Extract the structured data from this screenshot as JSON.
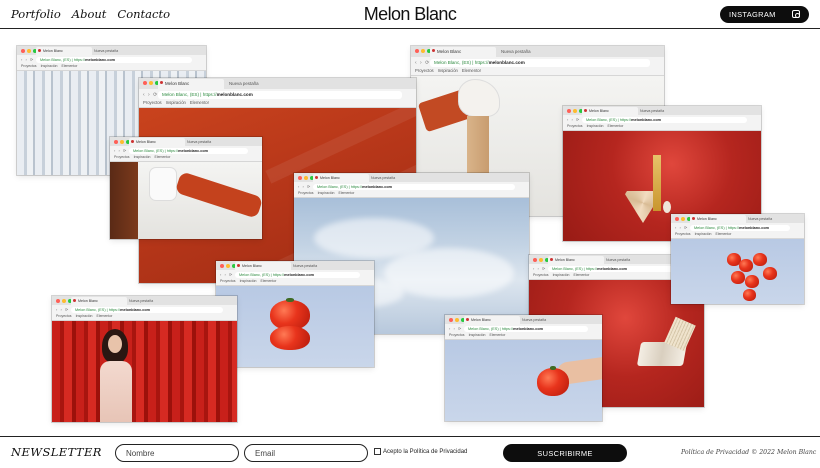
{
  "header": {
    "nav": [
      "Portfolio",
      "About",
      "Contacto"
    ],
    "brand": "Melon Blanc",
    "instagram_label": "INSTAGRAM"
  },
  "browser": {
    "tab_title": "Melon Blanc",
    "new_tab": "Nueva pestaña",
    "address_prefix": "Melon Blanc, (ES) | https://",
    "address_domain": "melonblanc.com",
    "bookmarks": [
      "Proyectos",
      "Inspiración",
      "Elementor"
    ]
  },
  "footer": {
    "newsletter_title": "NEWSLETTER",
    "name_placeholder": "Nombre",
    "email_placeholder": "Email",
    "privacy_checkbox": "Acepto la Política de Privacidad",
    "subscribe_label": "SUSCRIBIRME",
    "legal": "Política de Privacidad © 2022 Melon Blanc"
  },
  "colors": {
    "ink": "#111111",
    "button_bg": "#0d0d0d",
    "accent_red": "#c9431d",
    "url_green": "#2b8a3e"
  }
}
